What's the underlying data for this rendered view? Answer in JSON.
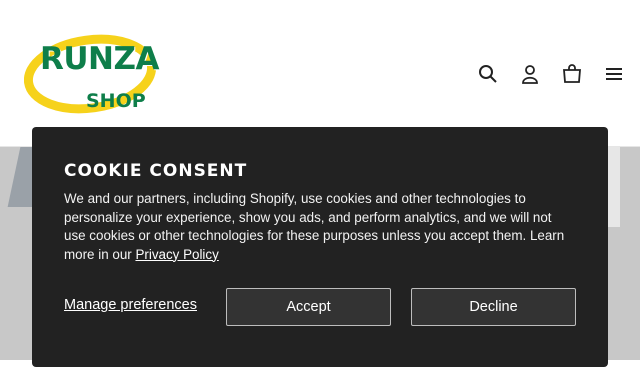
{
  "logo": {
    "main_text": "RUNZA",
    "sub_text": "SHOP",
    "brand_green": "#0e7e4a",
    "brand_yellow": "#f6d21b"
  },
  "header": {
    "icons": [
      "search-icon",
      "account-icon",
      "cart-icon",
      "menu-icon"
    ]
  },
  "cookie_banner": {
    "title": "COOKIE CONSENT",
    "text_before_link": "We and our partners, including Shopify, use cookies and other technologies to personalize your experience, show you ads, and perform analytics, and we will not use cookies or other technologies for these purposes unless you accept them. Learn more in our ",
    "privacy_link": "Privacy Policy",
    "manage_label": "Manage preferences",
    "accept_label": "Accept",
    "decline_label": "Decline",
    "background": "#222222"
  }
}
